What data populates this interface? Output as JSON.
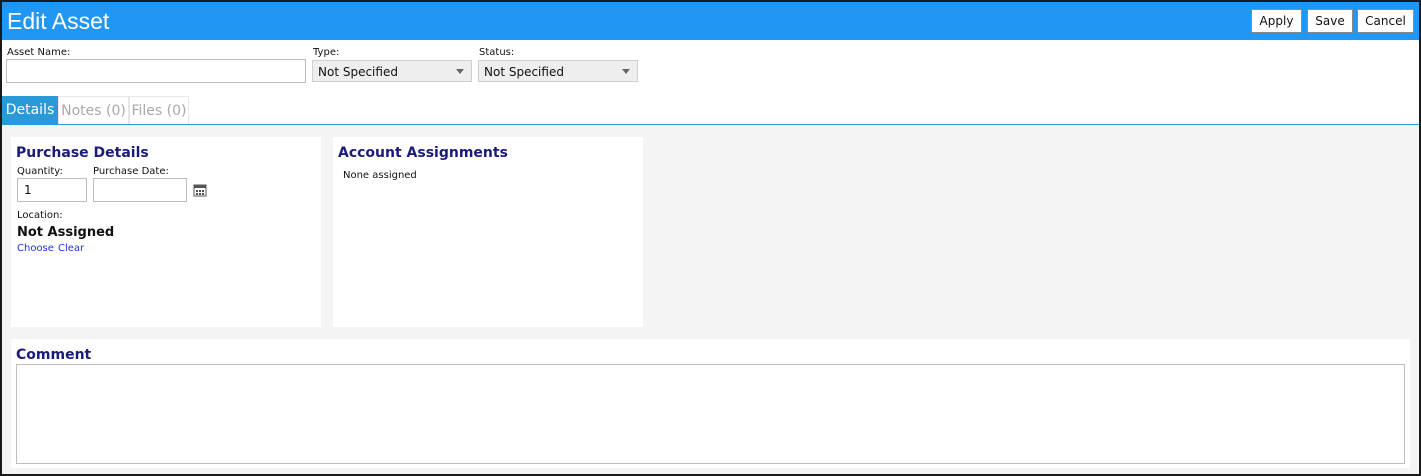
{
  "window": {
    "title": "Edit Asset",
    "actions": {
      "apply": "Apply",
      "save": "Save",
      "cancel": "Cancel"
    }
  },
  "asset_form": {
    "name": {
      "label": "Asset Name:",
      "value": ""
    },
    "type": {
      "label": "Type:",
      "selected": "Not Specified"
    },
    "status": {
      "label": "Status:",
      "selected": "Not Specified"
    }
  },
  "tabs": [
    {
      "label": "Details",
      "active": true
    },
    {
      "label": "Notes (0)",
      "active": false
    },
    {
      "label": "Files (0)",
      "active": false
    }
  ],
  "purchase": {
    "title": "Purchase Details",
    "quantity": {
      "label": "Quantity:",
      "value": "1"
    },
    "purchase_date": {
      "label": "Purchase Date:",
      "value": ""
    },
    "location": {
      "label": "Location:",
      "value": "Not Assigned",
      "choose": "Choose",
      "clear": "Clear"
    }
  },
  "accounts": {
    "title": "Account Assignments",
    "empty_text": "None assigned"
  },
  "comment": {
    "title": "Comment",
    "value": ""
  },
  "icons": {
    "calendar": "calendar-icon",
    "dropdown": "chevron-down-icon"
  },
  "colors": {
    "title_bar": "#2196f3",
    "tab_active": "#2a99d8",
    "section_title": "#1b1b7a",
    "link": "#2233cc",
    "content_bg": "#f4f4f4"
  }
}
